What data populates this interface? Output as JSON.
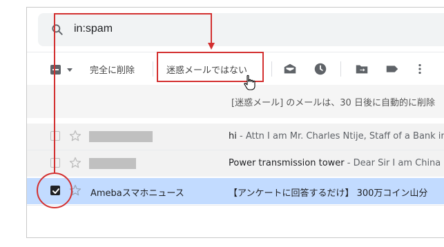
{
  "search": {
    "query": "in:spam",
    "icon": "search-icon"
  },
  "toolbar": {
    "delete_forever_label": "完全に削除",
    "not_spam_label": "迷惑メールではない",
    "icons": [
      "select-checkbox-icon",
      "dropdown-caret-icon",
      "mark-as-read-icon",
      "snooze-clock-icon",
      "move-to-icon",
      "label-icon",
      "more-vert-icon"
    ]
  },
  "notice": {
    "text": "[迷惑メール] のメールは、30 日後に自動的に削除"
  },
  "emails": [
    {
      "sender": "",
      "subject": "hi",
      "preview": " - Attn I am Mr. Charles Ntije, Staff of a Bank in",
      "selected": false
    },
    {
      "sender": "",
      "subject": "Power transmission tower",
      "preview": " - Dear Sir I am China R",
      "selected": false
    },
    {
      "sender": "Amebaスマホニュース",
      "subject": "【アンケートに回答するだけ】 300万コイン山分",
      "preview": "",
      "selected": true
    }
  ],
  "colors": {
    "annotation_red": "#d32f2f",
    "selected_row": "#c2dbff",
    "search_bg": "#f1f3f4"
  }
}
